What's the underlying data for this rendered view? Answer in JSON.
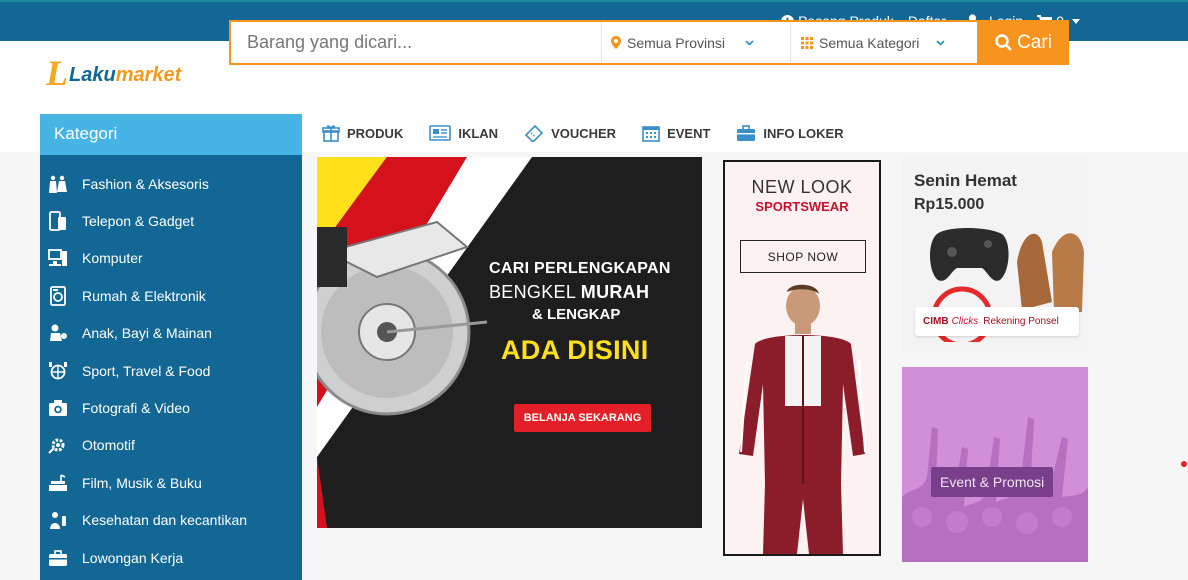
{
  "topbar": {
    "pasang_produk": "Pasang Produk",
    "daftar": "Daftar",
    "login": "Login",
    "cart_count": "0"
  },
  "logo": {
    "mark": "L",
    "laku": "Laku",
    "market": "market"
  },
  "search": {
    "placeholder": "Barang yang dicari...",
    "value": "",
    "province": "Semua Provinsi",
    "category": "Semua Kategori",
    "button": "Cari"
  },
  "sidebar": {
    "title": "Kategori",
    "items": [
      {
        "label": "Fashion & Aksesoris",
        "icon": "fashion-icon"
      },
      {
        "label": "Telepon & Gadget",
        "icon": "phone-icon"
      },
      {
        "label": "Komputer",
        "icon": "computer-icon"
      },
      {
        "label": "Rumah & Elektronik",
        "icon": "washing-machine-icon"
      },
      {
        "label": "Anak, Bayi & Mainan",
        "icon": "toys-icon"
      },
      {
        "label": "Sport, Travel & Food",
        "icon": "sport-icon"
      },
      {
        "label": "Fotografi & Video",
        "icon": "camera-icon"
      },
      {
        "label": "Otomotif",
        "icon": "automotive-icon"
      },
      {
        "label": "Film, Musik & Buku",
        "icon": "media-icon"
      },
      {
        "label": "Kesehatan dan kecantikan",
        "icon": "health-icon"
      },
      {
        "label": "Lowongan Kerja",
        "icon": "briefcase-icon"
      }
    ]
  },
  "nav": {
    "produk": "PRODUK",
    "iklan": "IKLAN",
    "voucher": "VOUCHER",
    "event": "EVENT",
    "info_loker": "INFO LOKER"
  },
  "banners": {
    "main": {
      "line1": "CARI PERLENGKAPAN",
      "line2a": "BENGKEL ",
      "line2b": "MURAH",
      "line3": "& LENGKAP",
      "line4": "ADA DISINI",
      "button": "BELANJA SEKARANG"
    },
    "sport": {
      "line1": "NEW LOOK",
      "line2": "SPORTSWEAR",
      "button": "SHOP NOW"
    },
    "hemat": {
      "line1": "Senin Hemat",
      "line2": "Rp15.000",
      "cimb": "CIMB",
      "clicks": "Clicks",
      "rekening": "Rekening Ponsel"
    },
    "event": {
      "label": "Event & Promosi"
    }
  },
  "colors": {
    "topbar": "#136794",
    "accent_orange": "#f7941d",
    "sidebar": "#136794",
    "sidebar_head": "#47b4e6",
    "banner_red": "#e3202a",
    "banner_yellow": "#ffe01b"
  }
}
